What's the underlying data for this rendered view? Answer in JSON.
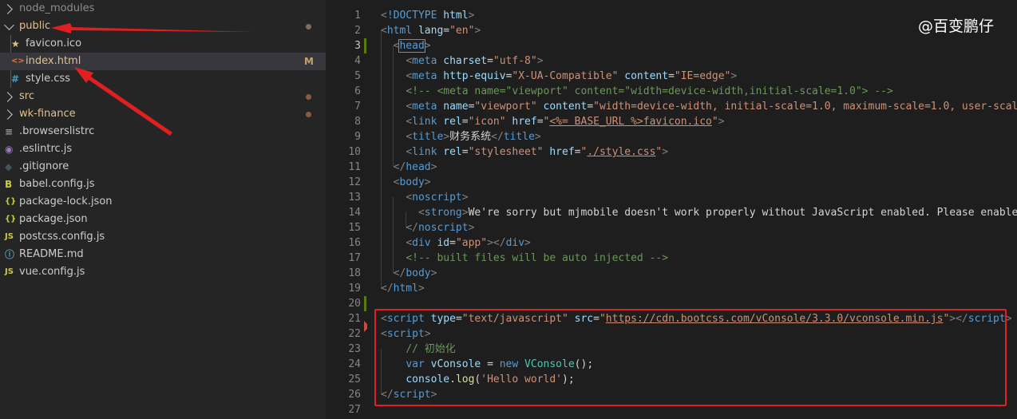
{
  "explorer": {
    "items": [
      {
        "label": "node_modules",
        "type": "folder",
        "state": "collapsed",
        "icon": "chevron-right-icon"
      },
      {
        "label": "public",
        "type": "folder",
        "state": "expanded",
        "icon": "chevron-down-icon",
        "decoration": "dot"
      },
      {
        "label": "favicon.ico",
        "type": "file",
        "icon": "star-icon",
        "icon_glyph": "★",
        "icon_color": "#e5c07b"
      },
      {
        "label": "index.html",
        "type": "file",
        "icon": "html-icon",
        "icon_glyph": "<>",
        "icon_color": "#e37933",
        "badge": "M",
        "selected": true
      },
      {
        "label": "style.css",
        "type": "file",
        "icon": "css-icon",
        "icon_glyph": "#",
        "icon_color": "#519aba"
      },
      {
        "label": "src",
        "type": "folder",
        "state": "collapsed",
        "icon": "chevron-right-icon",
        "decoration": "dot"
      },
      {
        "label": "wk-finance",
        "type": "folder",
        "state": "collapsed",
        "icon": "chevron-right-icon",
        "decoration": "dot"
      },
      {
        "label": ".browserslistrc",
        "type": "file",
        "icon": "config-icon",
        "icon_glyph": "≡",
        "icon_color": "#9e9e9e"
      },
      {
        "label": ".eslintrc.js",
        "type": "file",
        "icon": "eslint-icon",
        "icon_glyph": "◉",
        "icon_color": "#a074c4"
      },
      {
        "label": ".gitignore",
        "type": "file",
        "icon": "git-icon",
        "icon_glyph": "◆",
        "icon_color": "#41535b"
      },
      {
        "label": "babel.config.js",
        "type": "file",
        "icon": "babel-icon",
        "icon_glyph": "B",
        "icon_color": "#cbcb41"
      },
      {
        "label": "package-lock.json",
        "type": "file",
        "icon": "json-icon",
        "icon_glyph": "{}",
        "icon_color": "#cbcb41"
      },
      {
        "label": "package.json",
        "type": "file",
        "icon": "json-icon",
        "icon_glyph": "{}",
        "icon_color": "#cbcb41"
      },
      {
        "label": "postcss.config.js",
        "type": "file",
        "icon": "js-icon",
        "icon_glyph": "JS",
        "icon_color": "#cbcb41"
      },
      {
        "label": "README.md",
        "type": "file",
        "icon": "info-icon",
        "icon_glyph": "ⓘ",
        "icon_color": "#519aba"
      },
      {
        "label": "vue.config.js",
        "type": "file",
        "icon": "js-icon",
        "icon_glyph": "JS",
        "icon_color": "#cbcb41"
      }
    ]
  },
  "editor": {
    "current_line": 3,
    "lines": [
      {
        "n": "1",
        "tokens": [
          [
            "p",
            "<"
          ],
          [
            "t",
            "!DOCTYPE"
          ],
          [
            "tx",
            " "
          ],
          [
            "a",
            "html"
          ],
          [
            "p",
            ">"
          ]
        ]
      },
      {
        "n": "2",
        "tokens": [
          [
            "p",
            "<"
          ],
          [
            "t",
            "html"
          ],
          [
            "tx",
            " "
          ],
          [
            "a",
            "lang"
          ],
          [
            "tx",
            "="
          ],
          [
            "s",
            "\"en\""
          ],
          [
            "p",
            ">"
          ]
        ]
      },
      {
        "n": "3",
        "tokens": [
          [
            "tx",
            "  "
          ],
          [
            "p",
            "<"
          ],
          [
            "t",
            "head"
          ],
          [
            "p",
            ">"
          ]
        ]
      },
      {
        "n": "4",
        "tokens": [
          [
            "tx",
            "    "
          ],
          [
            "p",
            "<"
          ],
          [
            "t",
            "meta"
          ],
          [
            "tx",
            " "
          ],
          [
            "a",
            "charset"
          ],
          [
            "tx",
            "="
          ],
          [
            "s",
            "\"utf-8\""
          ],
          [
            "p",
            ">"
          ]
        ]
      },
      {
        "n": "5",
        "tokens": [
          [
            "tx",
            "    "
          ],
          [
            "p",
            "<"
          ],
          [
            "t",
            "meta"
          ],
          [
            "tx",
            " "
          ],
          [
            "a",
            "http-equiv"
          ],
          [
            "tx",
            "="
          ],
          [
            "s",
            "\"X-UA-Compatible\""
          ],
          [
            "tx",
            " "
          ],
          [
            "a",
            "content"
          ],
          [
            "tx",
            "="
          ],
          [
            "s",
            "\"IE=edge\""
          ],
          [
            "p",
            ">"
          ]
        ]
      },
      {
        "n": "6",
        "tokens": [
          [
            "tx",
            "    "
          ],
          [
            "c",
            "<!-- <meta name=\"viewport\" content=\"width=device-width,initial-scale=1.0\"> -->"
          ]
        ]
      },
      {
        "n": "7",
        "tokens": [
          [
            "tx",
            "    "
          ],
          [
            "p",
            "<"
          ],
          [
            "t",
            "meta"
          ],
          [
            "tx",
            " "
          ],
          [
            "a",
            "name"
          ],
          [
            "tx",
            "="
          ],
          [
            "s",
            "\"viewport\""
          ],
          [
            "tx",
            " "
          ],
          [
            "a",
            "content"
          ],
          [
            "tx",
            "="
          ],
          [
            "s",
            "\"width=device-width, initial-scale=1.0, maximum-scale=1.0, user-scalable=no\""
          ],
          [
            "p",
            ">"
          ]
        ]
      },
      {
        "n": "8",
        "tokens": [
          [
            "tx",
            "    "
          ],
          [
            "p",
            "<"
          ],
          [
            "t",
            "link"
          ],
          [
            "tx",
            " "
          ],
          [
            "a",
            "rel"
          ],
          [
            "tx",
            "="
          ],
          [
            "s",
            "\"icon\""
          ],
          [
            "tx",
            " "
          ],
          [
            "a",
            "href"
          ],
          [
            "tx",
            "="
          ],
          [
            "s",
            "\""
          ],
          [
            "su",
            "<%= BASE_URL %>favicon.ico"
          ],
          [
            "s",
            "\""
          ],
          [
            "p",
            ">"
          ]
        ]
      },
      {
        "n": "9",
        "tokens": [
          [
            "tx",
            "    "
          ],
          [
            "p",
            "<"
          ],
          [
            "t",
            "title"
          ],
          [
            "p",
            ">"
          ],
          [
            "tx",
            "财务系统"
          ],
          [
            "p",
            "</"
          ],
          [
            "t",
            "title"
          ],
          [
            "p",
            ">"
          ]
        ]
      },
      {
        "n": "10",
        "tokens": [
          [
            "tx",
            "    "
          ],
          [
            "p",
            "<"
          ],
          [
            "t",
            "link"
          ],
          [
            "tx",
            " "
          ],
          [
            "a",
            "rel"
          ],
          [
            "tx",
            "="
          ],
          [
            "s",
            "\"stylesheet\""
          ],
          [
            "tx",
            " "
          ],
          [
            "a",
            "href"
          ],
          [
            "tx",
            "="
          ],
          [
            "s",
            "\""
          ],
          [
            "su",
            "./style.css"
          ],
          [
            "s",
            "\""
          ],
          [
            "p",
            ">"
          ]
        ]
      },
      {
        "n": "11",
        "tokens": [
          [
            "tx",
            "  "
          ],
          [
            "p",
            "</"
          ],
          [
            "t",
            "head"
          ],
          [
            "p",
            ">"
          ]
        ]
      },
      {
        "n": "12",
        "tokens": [
          [
            "tx",
            "  "
          ],
          [
            "p",
            "<"
          ],
          [
            "t",
            "body"
          ],
          [
            "p",
            ">"
          ]
        ]
      },
      {
        "n": "13",
        "tokens": [
          [
            "tx",
            "    "
          ],
          [
            "p",
            "<"
          ],
          [
            "t",
            "noscript"
          ],
          [
            "p",
            ">"
          ]
        ]
      },
      {
        "n": "14",
        "tokens": [
          [
            "tx",
            "      "
          ],
          [
            "p",
            "<"
          ],
          [
            "t",
            "strong"
          ],
          [
            "p",
            ">"
          ],
          [
            "tx",
            "We're sorry but mjmobile doesn't work properly without JavaScript enabled. Please enable it to continue."
          ]
        ]
      },
      {
        "n": "15",
        "tokens": [
          [
            "tx",
            "    "
          ],
          [
            "p",
            "</"
          ],
          [
            "t",
            "noscript"
          ],
          [
            "p",
            ">"
          ]
        ]
      },
      {
        "n": "16",
        "tokens": [
          [
            "tx",
            "    "
          ],
          [
            "p",
            "<"
          ],
          [
            "t",
            "div"
          ],
          [
            "tx",
            " "
          ],
          [
            "a",
            "id"
          ],
          [
            "tx",
            "="
          ],
          [
            "s",
            "\"app\""
          ],
          [
            "p",
            "></"
          ],
          [
            "t",
            "div"
          ],
          [
            "p",
            ">"
          ]
        ]
      },
      {
        "n": "17",
        "tokens": [
          [
            "tx",
            "    "
          ],
          [
            "c",
            "<!-- built files will be auto injected -->"
          ]
        ]
      },
      {
        "n": "18",
        "tokens": [
          [
            "tx",
            "  "
          ],
          [
            "p",
            "</"
          ],
          [
            "t",
            "body"
          ],
          [
            "p",
            ">"
          ]
        ]
      },
      {
        "n": "19",
        "tokens": [
          [
            "p",
            "</"
          ],
          [
            "t",
            "html"
          ],
          [
            "p",
            ">"
          ]
        ]
      },
      {
        "n": "20",
        "tokens": []
      },
      {
        "n": "21",
        "tokens": [
          [
            "p",
            "<"
          ],
          [
            "t",
            "script"
          ],
          [
            "tx",
            " "
          ],
          [
            "a",
            "type"
          ],
          [
            "tx",
            "="
          ],
          [
            "s",
            "\"text/javascript\""
          ],
          [
            "tx",
            " "
          ],
          [
            "a",
            "src"
          ],
          [
            "tx",
            "="
          ],
          [
            "s",
            "\""
          ],
          [
            "su",
            "https://cdn.bootcss.com/vConsole/3.3.0/vconsole.min.js"
          ],
          [
            "s",
            "\""
          ],
          [
            "p",
            "></"
          ],
          [
            "t",
            "script"
          ],
          [
            "p",
            ">"
          ]
        ]
      },
      {
        "n": "22",
        "tokens": [
          [
            "p",
            "<"
          ],
          [
            "t",
            "script"
          ],
          [
            "p",
            ">"
          ]
        ]
      },
      {
        "n": "23",
        "tokens": [
          [
            "tx",
            "    "
          ],
          [
            "c",
            "// 初始化"
          ]
        ]
      },
      {
        "n": "24",
        "tokens": [
          [
            "tx",
            "    "
          ],
          [
            "k",
            "var"
          ],
          [
            "tx",
            " "
          ],
          [
            "a",
            "vConsole"
          ],
          [
            "tx",
            " = "
          ],
          [
            "k",
            "new"
          ],
          [
            "tx",
            " "
          ],
          [
            "cl",
            "VConsole"
          ],
          [
            "tx",
            "();"
          ]
        ]
      },
      {
        "n": "25",
        "tokens": [
          [
            "tx",
            "    "
          ],
          [
            "a",
            "console"
          ],
          [
            "tx",
            "."
          ],
          [
            "f",
            "log"
          ],
          [
            "tx",
            "("
          ],
          [
            "s",
            "'Hello world'"
          ],
          [
            "tx",
            ");"
          ]
        ]
      },
      {
        "n": "26",
        "tokens": [
          [
            "p",
            "</"
          ],
          [
            "t",
            "script"
          ],
          [
            "p",
            ">"
          ]
        ]
      },
      {
        "n": "27",
        "tokens": []
      }
    ]
  },
  "watermark": "@百变鹏仔",
  "colors": {
    "annotation": "#e02020",
    "sidebar_bg": "#252526",
    "editor_bg": "#1e1e1e",
    "selected_row": "#37373d"
  }
}
